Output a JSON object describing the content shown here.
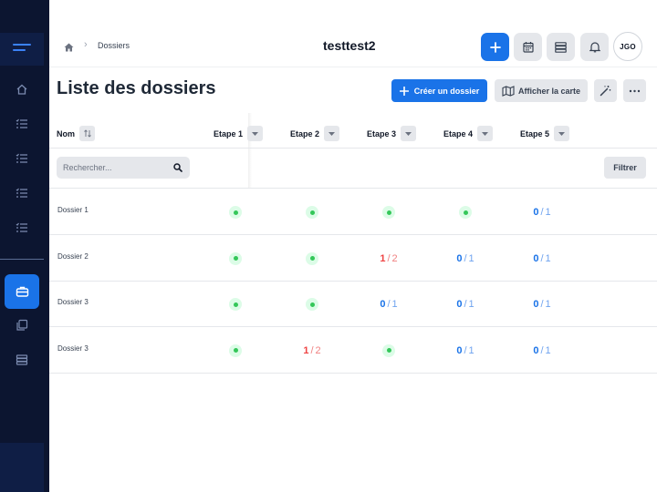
{
  "header": {
    "breadcrumb": "Dossiers",
    "title": "testtest2",
    "avatar_initials": "JGO"
  },
  "page": {
    "title": "Liste des dossiers",
    "create_label": "Créer un dossier",
    "map_label": "Afficher la carte"
  },
  "table": {
    "name_header": "Nom",
    "step_headers": [
      "Etape 1",
      "Etape 2",
      "Etape 3",
      "Etape 4",
      "Etape 5"
    ],
    "search_placeholder": "Rechercher...",
    "filter_label": "Filtrer",
    "rows": [
      {
        "name": "Dossier 1",
        "cells": [
          {
            "type": "done"
          },
          {
            "type": "done"
          },
          {
            "type": "done"
          },
          {
            "type": "done"
          },
          {
            "type": "progress",
            "done": "0",
            "total": "1",
            "color": "blue"
          }
        ]
      },
      {
        "name": "Dossier 2",
        "cells": [
          {
            "type": "done"
          },
          {
            "type": "done"
          },
          {
            "type": "progress",
            "done": "1",
            "total": "2",
            "color": "red"
          },
          {
            "type": "progress",
            "done": "0",
            "total": "1",
            "color": "blue"
          },
          {
            "type": "progress",
            "done": "0",
            "total": "1",
            "color": "blue"
          }
        ]
      },
      {
        "name": "Dossier 3",
        "cells": [
          {
            "type": "done"
          },
          {
            "type": "done"
          },
          {
            "type": "progress",
            "done": "0",
            "total": "1",
            "color": "blue"
          },
          {
            "type": "progress",
            "done": "0",
            "total": "1",
            "color": "blue"
          },
          {
            "type": "progress",
            "done": "0",
            "total": "1",
            "color": "blue"
          }
        ]
      },
      {
        "name": "Dossier 3",
        "cells": [
          {
            "type": "done"
          },
          {
            "type": "progress",
            "done": "1",
            "total": "2",
            "color": "red"
          },
          {
            "type": "done"
          },
          {
            "type": "progress",
            "done": "0",
            "total": "1",
            "color": "blue"
          },
          {
            "type": "progress",
            "done": "0",
            "total": "1",
            "color": "blue"
          }
        ]
      }
    ]
  },
  "colors": {
    "sidebar_bg": "#0c1530",
    "accent": "#1a73e8",
    "done_green": "#34c759",
    "error_red": "#ef4444"
  },
  "icons": {
    "sidebar": [
      "menu-icon",
      "home-icon",
      "list-icon",
      "list-icon",
      "list-icon",
      "list-icon",
      "briefcase-icon",
      "copy-icon",
      "database-icon"
    ],
    "header": [
      "home-icon",
      "plus-icon",
      "calendar-icon",
      "server-icon",
      "bell-icon"
    ]
  }
}
